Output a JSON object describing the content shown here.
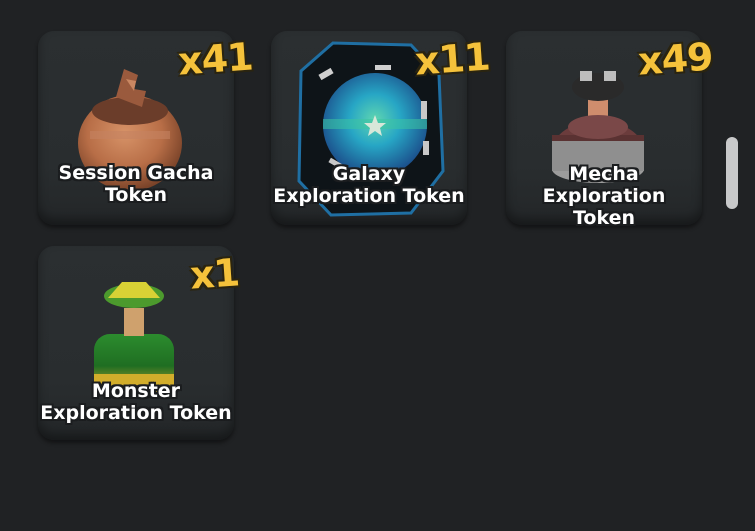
{
  "inventory": {
    "items": [
      {
        "name": "Session Gacha\nToken",
        "count": "x41"
      },
      {
        "name": "Galaxy\nExploration Token",
        "count": "x11"
      },
      {
        "name": "Mecha Exploration\nToken",
        "count": "x49"
      },
      {
        "name": "Monster\nExploration Token",
        "count": "x1"
      }
    ]
  },
  "icons": {
    "item_0": "session-gacha-token-icon",
    "item_1": "galaxy-exploration-token-icon",
    "item_2": "mecha-exploration-token-icon",
    "item_3": "monster-exploration-token-icon"
  },
  "colors": {
    "background": "#202224",
    "card": "#2b2f31",
    "count_text": "#f5c23b",
    "name_text": "#ffffff"
  }
}
